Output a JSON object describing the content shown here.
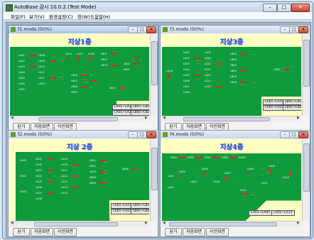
{
  "app": {
    "title": "AutoBase 감시 10.0.2 (Test Mode)",
    "controls": {
      "minimize": "–",
      "maximize": "□",
      "close": "✕"
    }
  },
  "menu": [
    "파일(F)",
    "보기(V)",
    "환경설정(C)",
    "창(W)",
    "도움말(H)"
  ],
  "windows": [
    {
      "caption": "f1.mods (50%)",
      "plan_title": "지상1층",
      "range_labels": [
        "LA01~LA25",
        "LB01~LB25",
        "LA01~LA25",
        "LB01~LB25"
      ],
      "nav": [
        "닫기",
        "처음화면",
        "이전화면"
      ]
    },
    {
      "caption": "f3.mods (50%)",
      "plan_title": "지상3층",
      "range_labels": [
        "LA01~LA15",
        "LB01~LB15",
        "LA01~LA25",
        "LB01~LB25"
      ],
      "nav": [
        "닫기",
        "처음화면",
        "이전화면"
      ]
    },
    {
      "caption": "f2.mods (50%)",
      "plan_title": "지상 2층",
      "range_labels": [
        "LA01~LA15",
        "LB01~LB15",
        "LA01~LA25",
        "LB01~LB25"
      ],
      "nav": [
        "닫기",
        "처음화면",
        "이전화면"
      ]
    },
    {
      "caption": "f4.mods (50%)",
      "plan_title": "지상4층",
      "range_labels": [
        "EA01~EA05",
        "LA01~LA15"
      ],
      "nav": [
        "닫기",
        "처음화면",
        "이전화면"
      ]
    }
  ],
  "colors": {
    "floor_green": "#0f9a3c",
    "plan_bg": "#ffffc2",
    "plan_title": "#2244cc",
    "marker": "#ee2222"
  }
}
